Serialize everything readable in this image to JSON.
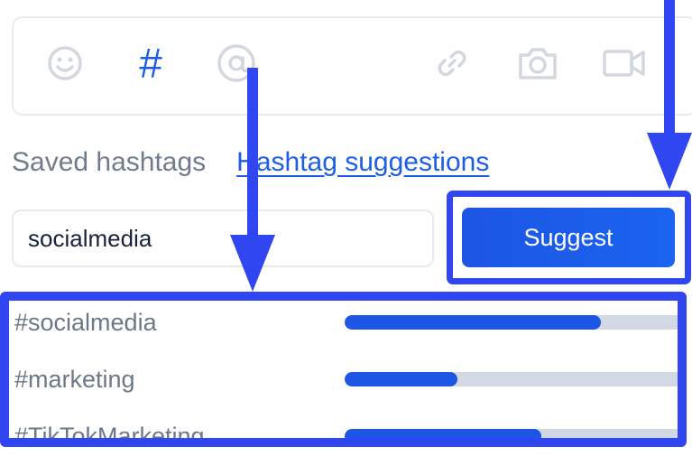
{
  "composer_toolbar": {
    "emoji_icon": "smiley-icon",
    "hashtag_symbol": "#",
    "mention_icon": "at-icon",
    "link_icon": "link-icon",
    "photo_icon": "camera-icon",
    "video_icon": "video-camera-icon"
  },
  "tabs": {
    "saved": "Saved hashtags",
    "suggestions": "Hashtag suggestions"
  },
  "search": {
    "value": "socialmedia"
  },
  "suggest_button": "Suggest",
  "results": [
    {
      "tag": "#socialmedia",
      "popularity": 0.77
    },
    {
      "tag": "#marketing",
      "popularity": 0.34
    },
    {
      "tag": "#TikTokMarketing",
      "popularity": 0.59
    }
  ],
  "colors": {
    "accent": "#1e5ee6",
    "annotation": "#2f46f0",
    "muted_text": "#707c8c",
    "bar_track": "#d3d9e4"
  }
}
